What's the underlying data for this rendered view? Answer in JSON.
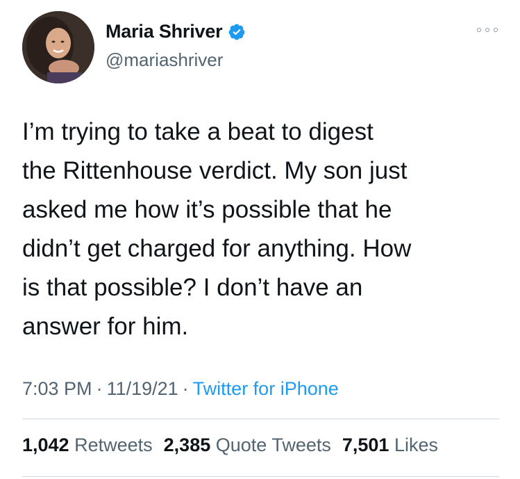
{
  "author": {
    "display_name": "Maria Shriver",
    "handle": "@mariashriver",
    "verified": true
  },
  "tweet": {
    "lines": [
      "I’m trying to take a beat to digest",
      "the Rittenhouse verdict. My son just",
      "asked me how it’s possible that he",
      "didn’t get charged for anything. How",
      "is that possible? I don’t have an",
      "answer for him."
    ]
  },
  "meta": {
    "time": "7:03 PM",
    "separator": "·",
    "date": "11/19/21",
    "source": "Twitter for iPhone"
  },
  "stats": {
    "retweets_count": "1,042",
    "retweets_label": "Retweets",
    "quote_count": "2,385",
    "quote_label": "Quote Tweets",
    "likes_count": "7,501",
    "likes_label": "Likes"
  },
  "icons": {
    "verified": "verified-badge-icon",
    "more": "more-options-icon"
  },
  "colors": {
    "text": "#0f1419",
    "secondary": "#536471",
    "link": "#1d9bf0",
    "divider": "#cfd9de"
  }
}
